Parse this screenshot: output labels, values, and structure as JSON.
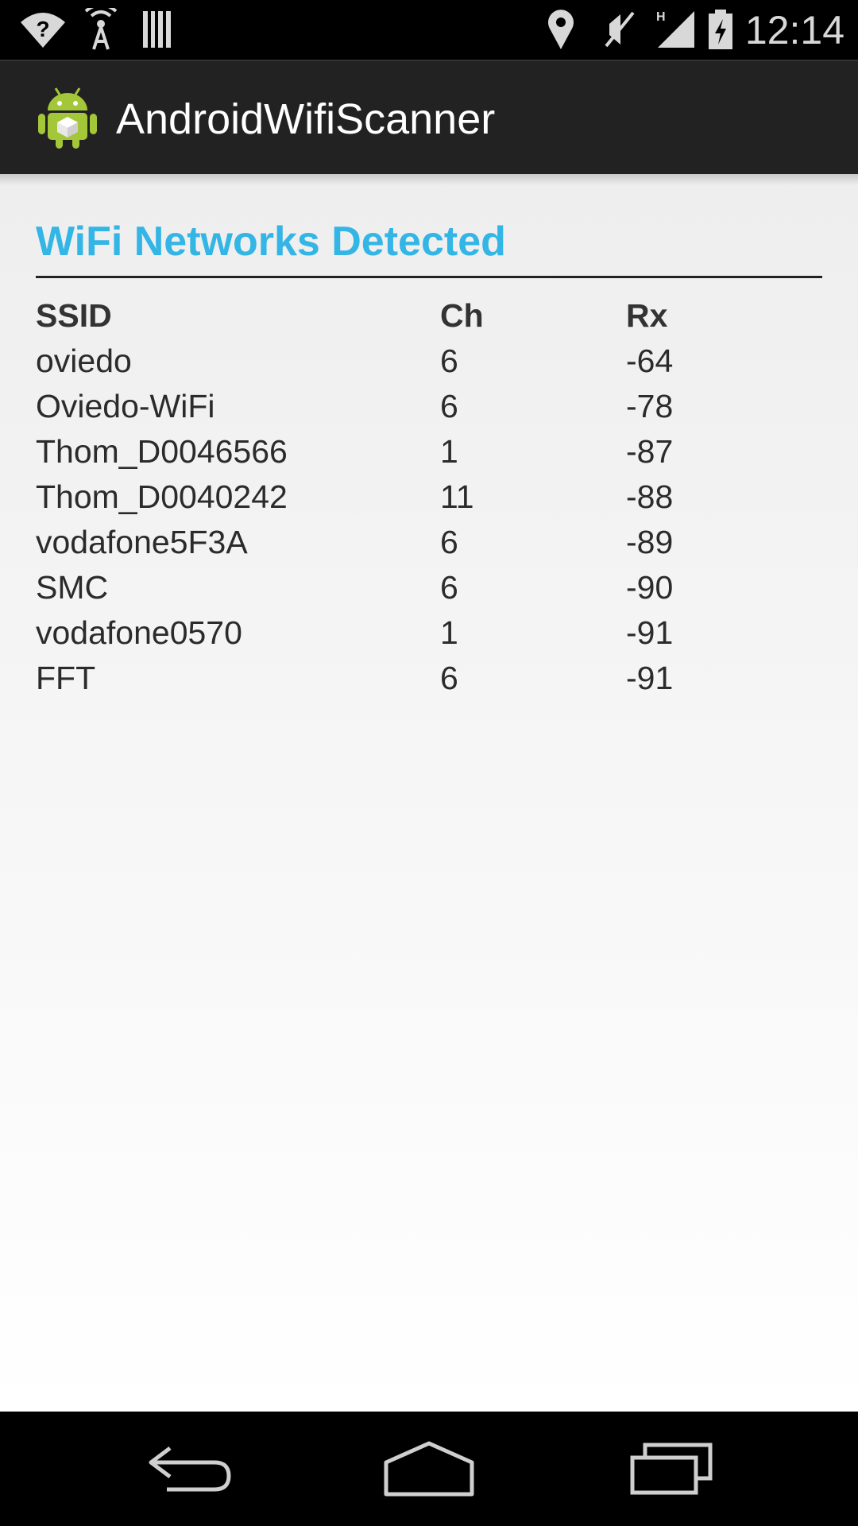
{
  "status_bar": {
    "time": "12:14",
    "icons": [
      "wifi-unknown-icon",
      "hotspot-icon",
      "barcode-icon",
      "location-icon",
      "mute-icon",
      "signal-h-icon",
      "battery-charging-icon"
    ]
  },
  "action_bar": {
    "title": "AndroidWifiScanner",
    "icon": "android-app-icon"
  },
  "main": {
    "heading": "WiFi Networks Detected",
    "accent_color": "#33b5e5",
    "columns": [
      "SSID",
      "Ch",
      "Rx"
    ],
    "rows": [
      {
        "ssid": "oviedo",
        "ch": "6",
        "rx": "-64"
      },
      {
        "ssid": "Oviedo-WiFi",
        "ch": "6",
        "rx": "-78"
      },
      {
        "ssid": "Thom_D0046566",
        "ch": "1",
        "rx": "-87"
      },
      {
        "ssid": "Thom_D0040242",
        "ch": "11",
        "rx": "-88"
      },
      {
        "ssid": "vodafone5F3A",
        "ch": "6",
        "rx": "-89"
      },
      {
        "ssid": "SMC",
        "ch": "6",
        "rx": "-90"
      },
      {
        "ssid": "vodafone0570",
        "ch": "1",
        "rx": "-91"
      },
      {
        "ssid": "FFT",
        "ch": "6",
        "rx": "-91"
      }
    ]
  },
  "nav_bar": {
    "buttons": [
      "back-icon",
      "home-icon",
      "recents-icon"
    ]
  }
}
